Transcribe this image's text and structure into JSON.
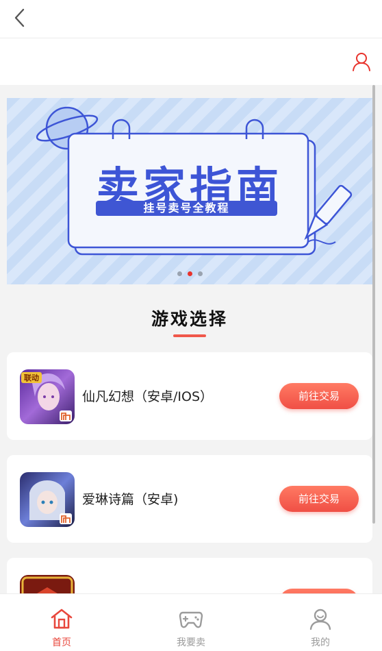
{
  "topbar": {
    "back_icon": "chevron-left-icon"
  },
  "header": {
    "user_icon": "user-icon",
    "accent_color": "#e8332c"
  },
  "banner": {
    "title": "卖家指南",
    "subtitle": "挂号卖号全教程",
    "dots_count": 3,
    "active_dot_index": 1
  },
  "section": {
    "title": "游戏选择"
  },
  "games": [
    {
      "name": "仙凡幻想（安卓/IOS）",
      "button_label": "前往交易",
      "avatar_badge": "联动"
    },
    {
      "name": "爱琳诗篇（安卓)",
      "button_label": "前往交易"
    },
    {
      "name": "",
      "button_label": ""
    }
  ],
  "tabbar": {
    "tabs": [
      {
        "label": "首页",
        "icon": "home-icon",
        "active": true
      },
      {
        "label": "我要卖",
        "icon": "gamepad-icon",
        "active": false
      },
      {
        "label": "我的",
        "icon": "profile-icon",
        "active": false
      }
    ]
  },
  "colors": {
    "primary": "#f04f45",
    "banner_blue": "#3d55d6"
  }
}
